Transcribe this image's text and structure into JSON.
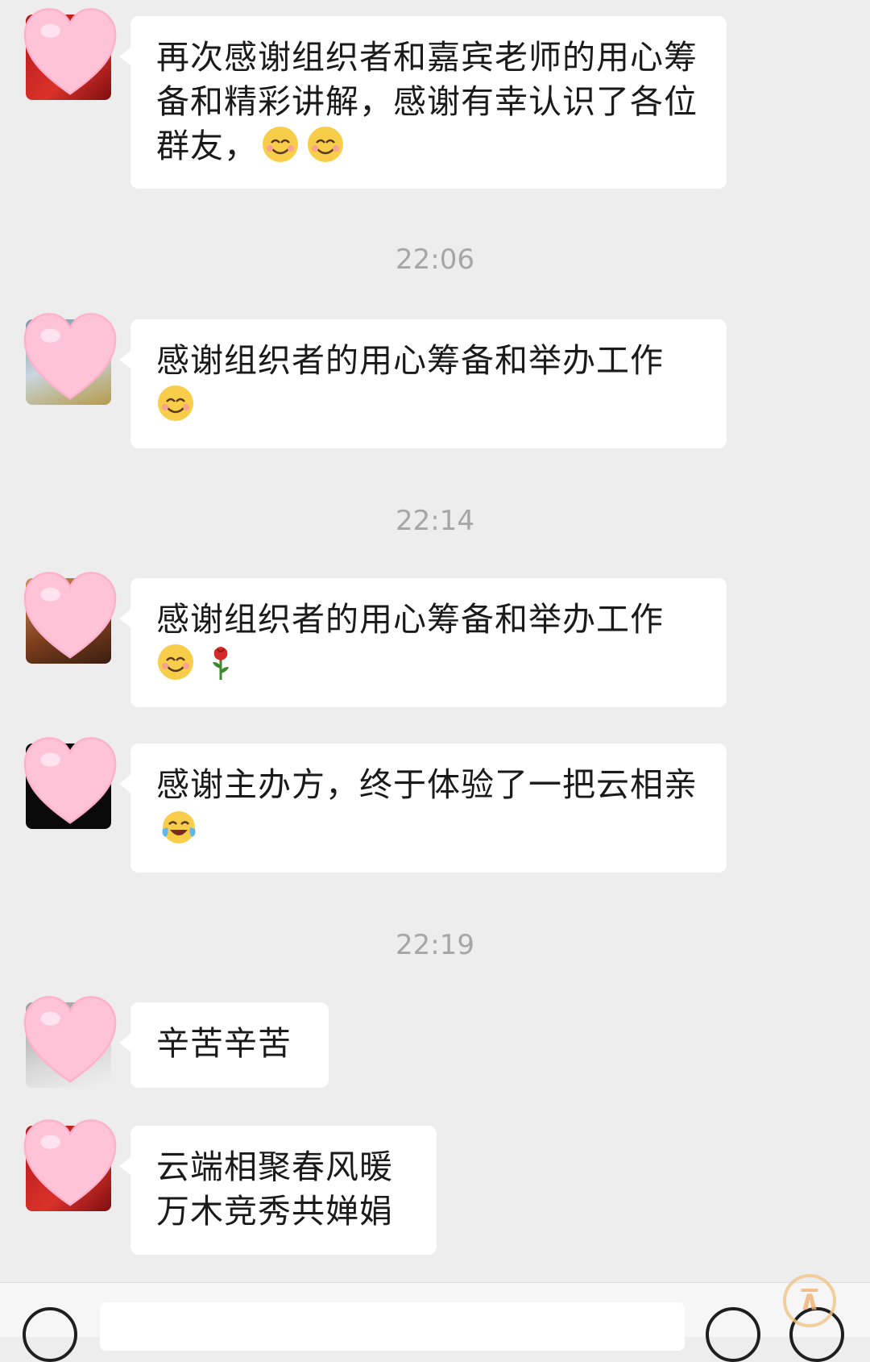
{
  "messages": [
    {
      "text": "再次感谢组织者和嘉宾老师的用心筹备和精彩讲解，感谢有幸认识了各位群友，",
      "emojis": [
        "smile-emoji",
        "smile-emoji"
      ]
    },
    {
      "text": "感谢组织者的用心筹备和举办工作",
      "emojis": [
        "smile-emoji"
      ]
    },
    {
      "text": "感谢组织者的用心筹备和举办工作",
      "emojis": [
        "smile-emoji",
        "rose-emoji"
      ]
    },
    {
      "text": "感谢主办方，终于体验了一把云相亲",
      "emojis": [
        "tears-of-joy-emoji"
      ]
    },
    {
      "text": "辛苦辛苦",
      "emojis": []
    },
    {
      "text": "云端相聚春风暖\n万木竞秀共婵娟",
      "lines": [
        "云端相聚春风暖",
        "万木竞秀共婵娟"
      ],
      "emojis": []
    }
  ],
  "timestamps": [
    "22:06",
    "22:14",
    "22:19"
  ],
  "colors": {
    "background": "#ededed",
    "bubble": "#ffffff",
    "heart_sticker": "#ffc0d6",
    "timestamp": "#a6a6a6"
  },
  "bottom_bar": {
    "icons": [
      "voice-icon",
      "emoji-button-icon",
      "plus-icon"
    ]
  }
}
